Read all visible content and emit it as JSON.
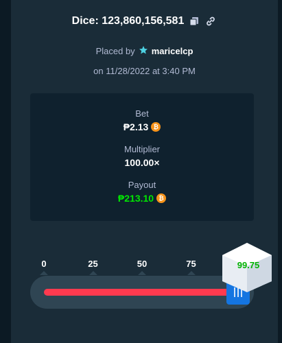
{
  "header": {
    "title": "Dice: 123,860,156,581",
    "placed_prefix": "Placed by",
    "username": "maricelcp",
    "date": "on 11/28/2022 at 3:40 PM"
  },
  "stats": {
    "bet_label": "Bet",
    "bet_value": "₱2.13",
    "multiplier_label": "Multiplier",
    "multiplier_value": "100.00×",
    "payout_label": "Payout",
    "payout_value": "₱213.10"
  },
  "slider": {
    "ticks": [
      "0",
      "25",
      "50",
      "75"
    ],
    "roll_target": 99.0,
    "result_label": "99.75",
    "result_value": 99.75
  },
  "colors": {
    "lose": "#ff3a4f",
    "win": "#00e701",
    "handle": "#1475e1",
    "coin": "#f7931a"
  },
  "icons": {
    "copy": "copy-icon",
    "link": "link-icon",
    "vip": "vip-star-icon",
    "coin": "bitcoin-icon"
  }
}
